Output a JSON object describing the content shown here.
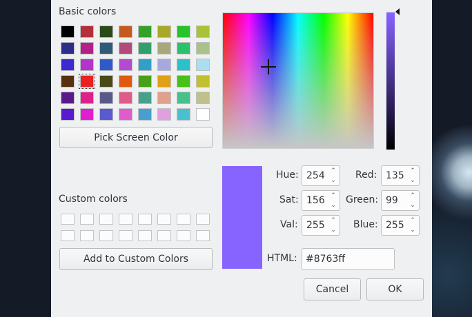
{
  "dialog": {
    "basic_colors_label": "Basic colors",
    "basic_colors": [
      "#000000",
      "#b3303a",
      "#2a4a1a",
      "#c65a1e",
      "#35a02a",
      "#a8a82a",
      "#28c22a",
      "#a8c23a",
      "#2d2d8a",
      "#b3208a",
      "#2f5a7a",
      "#b34a7a",
      "#30a06a",
      "#a8a87a",
      "#28c26a",
      "#a8c28a",
      "#3a2ad0",
      "#b334c8",
      "#2f5ac8",
      "#b34ad0",
      "#30a0c8",
      "#a8a8e0",
      "#28c2c8",
      "#a8e0f0",
      "#5a3010",
      "#e82222",
      "#4a4a18",
      "#e05a10",
      "#48a018",
      "#e0a018",
      "#48c018",
      "#c0c030",
      "#5a1a8a",
      "#e0208a",
      "#5a5a8a",
      "#e05a8a",
      "#48a08a",
      "#e0a08a",
      "#48c08a",
      "#c0c08a",
      "#5a1ad0",
      "#e020d0",
      "#5a5ad0",
      "#e05ad0",
      "#48a0d0",
      "#e0a0e0",
      "#48c0d0",
      "#ffffff"
    ],
    "pick_screen_label": "Pick Screen Color",
    "custom_colors_label": "Custom colors",
    "add_custom_label": "Add to Custom Colors",
    "fields": {
      "hue_label": "Hue:",
      "hue_value": "254",
      "sat_label": "Sat:",
      "sat_value": "156",
      "val_label": "Val:",
      "val_value": "255",
      "red_label": "Red:",
      "red_value": "135",
      "green_label": "Green:",
      "green_value": "99",
      "blue_label": "Blue:",
      "blue_value": "255",
      "html_label": "HTML:",
      "html_value": "#8763ff"
    },
    "current_color": "#8763ff",
    "cancel_label": "Cancel",
    "ok_label": "OK"
  }
}
